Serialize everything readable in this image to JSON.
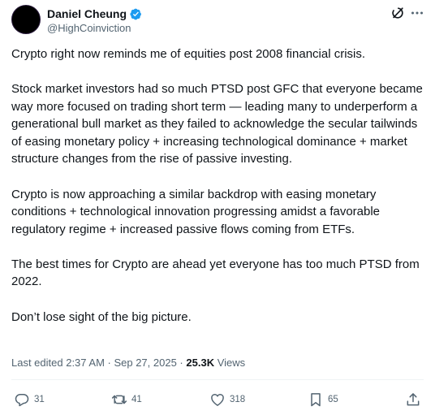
{
  "author": {
    "display_name": "Daniel Cheung",
    "handle": "@HighCoinviction",
    "verified": true
  },
  "tweet": {
    "paragraphs": [
      "Crypto right now reminds me of equities post 2008 financial crisis.",
      "Stock market investors had so much PTSD post GFC that everyone became way more focused on trading short term — leading many to underperform a generational bull market as they failed to acknowledge the secular tailwinds of easing monetary policy + increasing technological dominance + market structure changes from the rise of passive investing.",
      "Crypto is now approaching a similar backdrop with easing monetary conditions + technological innovation progressing amidst a favorable regulatory regime + increased passive flows coming from ETFs.",
      "The best times for Crypto are ahead yet everyone has too much PTSD from 2022.",
      "Don’t lose sight of the big picture."
    ]
  },
  "meta": {
    "edited": "Last edited 2:37 AM · Sep 27, 2025 ·",
    "views_count": "25.3K",
    "views_label": "Views"
  },
  "actions": {
    "replies": "31",
    "reposts": "41",
    "likes": "318",
    "bookmarks": "65"
  },
  "icons": {
    "verified": "verified-badge-icon",
    "grok": "grok-icon",
    "more": "more-icon",
    "reply": "reply-icon",
    "repost": "repost-icon",
    "like": "heart-icon",
    "bookmark": "bookmark-icon",
    "share": "share-icon"
  },
  "colors": {
    "text": "#0f1419",
    "secondary": "#536471",
    "verified": "#1d9bf0",
    "divider": "#eff3f4"
  }
}
